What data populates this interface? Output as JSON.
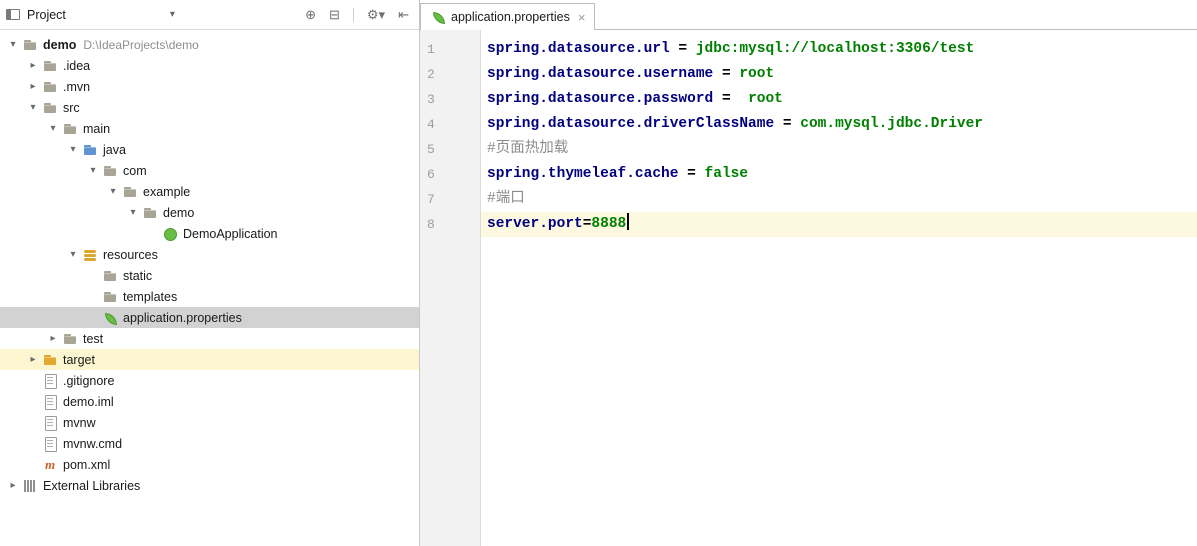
{
  "project_panel": {
    "header": {
      "title": "Project",
      "dropdown_glyph": "▾",
      "icons": [
        {
          "name": "locate",
          "glyph": "⊕"
        },
        {
          "name": "collapse-all",
          "glyph": "⊟"
        },
        {
          "name": "divider",
          "divider": true
        },
        {
          "name": "settings-gear",
          "glyph": "⚙▾"
        },
        {
          "name": "hide-panel",
          "glyph": "⇤"
        }
      ]
    },
    "glyphs": {
      "expanded": "▾",
      "collapsed": "▸"
    },
    "tree": [
      {
        "level": 0,
        "chevron": "expanded",
        "icon": "folder",
        "label": "demo",
        "bold": true,
        "extra": "D:\\IdeaProjects\\demo"
      },
      {
        "level": 1,
        "chevron": "collapsed",
        "icon": "folder",
        "label": ".idea"
      },
      {
        "level": 1,
        "chevron": "collapsed",
        "icon": "folder",
        "label": ".mvn"
      },
      {
        "level": 1,
        "chevron": "expanded",
        "icon": "folder",
        "label": "src"
      },
      {
        "level": 2,
        "chevron": "expanded",
        "icon": "folder",
        "label": "main"
      },
      {
        "level": 3,
        "chevron": "expanded",
        "icon": "folder-blue",
        "label": "java"
      },
      {
        "level": 4,
        "chevron": "expanded",
        "icon": "folder",
        "label": "com"
      },
      {
        "level": 5,
        "chevron": "expanded",
        "icon": "folder",
        "label": "example"
      },
      {
        "level": 6,
        "chevron": "expanded",
        "icon": "folder",
        "label": "demo"
      },
      {
        "level": 7,
        "chevron": "none",
        "icon": "spring-class",
        "label": "DemoApplication"
      },
      {
        "level": 3,
        "chevron": "expanded",
        "icon": "resources",
        "label": "resources"
      },
      {
        "level": 4,
        "chevron": "none",
        "icon": "folder",
        "label": "static"
      },
      {
        "level": 4,
        "chevron": "none",
        "icon": "folder",
        "label": "templates"
      },
      {
        "level": 4,
        "chevron": "none",
        "icon": "leaf",
        "label": "application.properties",
        "selected": true
      },
      {
        "level": 2,
        "chevron": "collapsed",
        "icon": "folder",
        "label": "test"
      },
      {
        "level": 1,
        "chevron": "collapsed",
        "icon": "folder-excluded",
        "label": "target",
        "highlight": true
      },
      {
        "level": 1,
        "chevron": "none",
        "icon": "file",
        "label": ".gitignore"
      },
      {
        "level": 1,
        "chevron": "none",
        "icon": "file",
        "label": "demo.iml"
      },
      {
        "level": 1,
        "chevron": "none",
        "icon": "file",
        "label": "mvnw"
      },
      {
        "level": 1,
        "chevron": "none",
        "icon": "file",
        "label": "mvnw.cmd"
      },
      {
        "level": 1,
        "chevron": "none",
        "icon": "maven",
        "label": "pom.xml"
      },
      {
        "level": 0,
        "chevron": "collapsed",
        "icon": "libraries",
        "label": "External Libraries"
      }
    ]
  },
  "editor": {
    "tab": {
      "label": "application.properties",
      "close_glyph": "×"
    },
    "lines": [
      {
        "num": "1",
        "segments": [
          {
            "t": "key",
            "text": "spring.datasource.url"
          },
          {
            "t": "op",
            "text": " = "
          },
          {
            "t": "val",
            "text": "jdbc:mysql://localhost:3306/test"
          }
        ]
      },
      {
        "num": "2",
        "segments": [
          {
            "t": "key",
            "text": "spring.datasource.username"
          },
          {
            "t": "op",
            "text": " = "
          },
          {
            "t": "val",
            "text": "root"
          }
        ]
      },
      {
        "num": "3",
        "segments": [
          {
            "t": "key",
            "text": "spring.datasource.password"
          },
          {
            "t": "op",
            "text": " =  "
          },
          {
            "t": "val",
            "text": "root"
          }
        ]
      },
      {
        "num": "4",
        "segments": [
          {
            "t": "key",
            "text": "spring.datasource.driverClassName"
          },
          {
            "t": "op",
            "text": " = "
          },
          {
            "t": "val",
            "text": "com.mysql.jdbc.Driver"
          }
        ]
      },
      {
        "num": "5",
        "segments": [
          {
            "t": "comment",
            "text": "#页面热加载"
          }
        ]
      },
      {
        "num": "6",
        "segments": [
          {
            "t": "key",
            "text": "spring.thymeleaf.cache"
          },
          {
            "t": "op",
            "text": " = "
          },
          {
            "t": "val",
            "text": "false"
          }
        ]
      },
      {
        "num": "7",
        "segments": [
          {
            "t": "comment",
            "text": "#端口"
          }
        ]
      },
      {
        "num": "8",
        "current": true,
        "cursor": true,
        "segments": [
          {
            "t": "key",
            "text": "server.port"
          },
          {
            "t": "op",
            "text": "="
          },
          {
            "t": "val",
            "text": "8888"
          }
        ]
      }
    ]
  },
  "icons": {
    "maven-m": "m"
  },
  "colors": {
    "key": "#000080",
    "value": "#008000",
    "comment": "#8c8c8c",
    "current_line": "#fcf9e0",
    "selected_row": "#d2d2d2",
    "highlight_row": "#fcf7d0",
    "spring_green": "#68bd45",
    "folder_blue": "#5e94d1",
    "folder_excluded": "#e3a82f"
  }
}
